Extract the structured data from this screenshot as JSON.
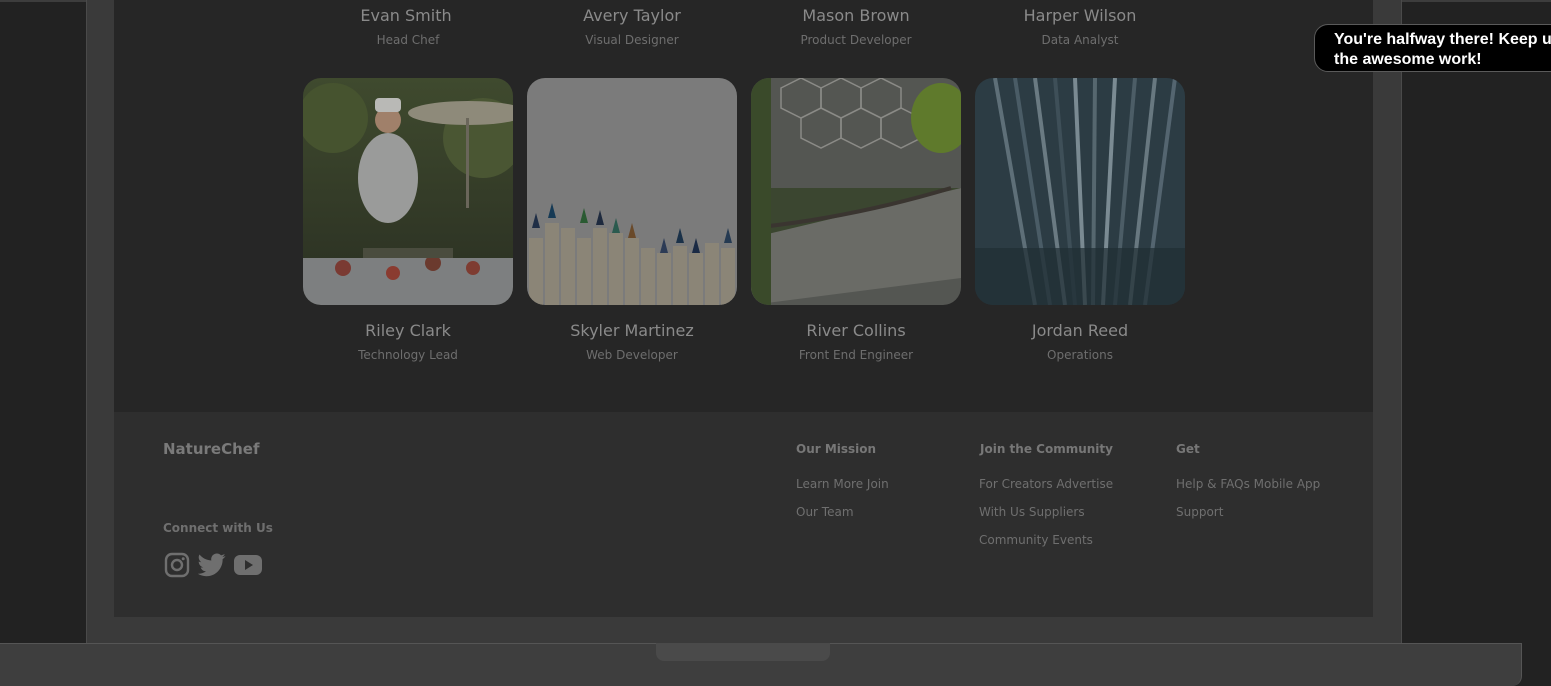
{
  "team": {
    "row1": [
      {
        "name": "Evan Smith",
        "role": "Head Chef"
      },
      {
        "name": "Avery Taylor",
        "role": "Visual Designer"
      },
      {
        "name": "Mason Brown",
        "role": "Product Developer"
      },
      {
        "name": "Harper Wilson",
        "role": "Data Analyst"
      }
    ],
    "row2": [
      {
        "name": "Riley Clark",
        "role": "Technology Lead",
        "photo": "chef-outdoor-table"
      },
      {
        "name": "Skyler Martinez",
        "role": "Web Developer",
        "photo": "colored-pencils"
      },
      {
        "name": "River Collins",
        "role": "Front End Engineer",
        "photo": "rainforest-biome-bridge"
      },
      {
        "name": "Jordan Reed",
        "role": "Operations",
        "photo": "abstract-light-streaks"
      }
    ]
  },
  "footer": {
    "brand": "NatureChef",
    "connect_label": "Connect with Us",
    "social_icons": [
      "instagram-icon",
      "twitter-icon",
      "youtube-icon"
    ],
    "columns": [
      {
        "title": "Our Mission",
        "links": [
          "Learn More Join",
          "Our Team"
        ]
      },
      {
        "title": "Join the Community",
        "links": [
          "For Creators Advertise",
          "With Us Suppliers",
          "Community Events"
        ]
      },
      {
        "title": "Get",
        "links": [
          "Help & FAQs Mobile App",
          "Support"
        ]
      }
    ]
  },
  "toast": {
    "message": "You're halfway there! Keep up the awesome work!"
  },
  "colors": {
    "overlay_bg": "#222222",
    "toast_bg": "#000000",
    "toast_text": "#ffffff"
  }
}
